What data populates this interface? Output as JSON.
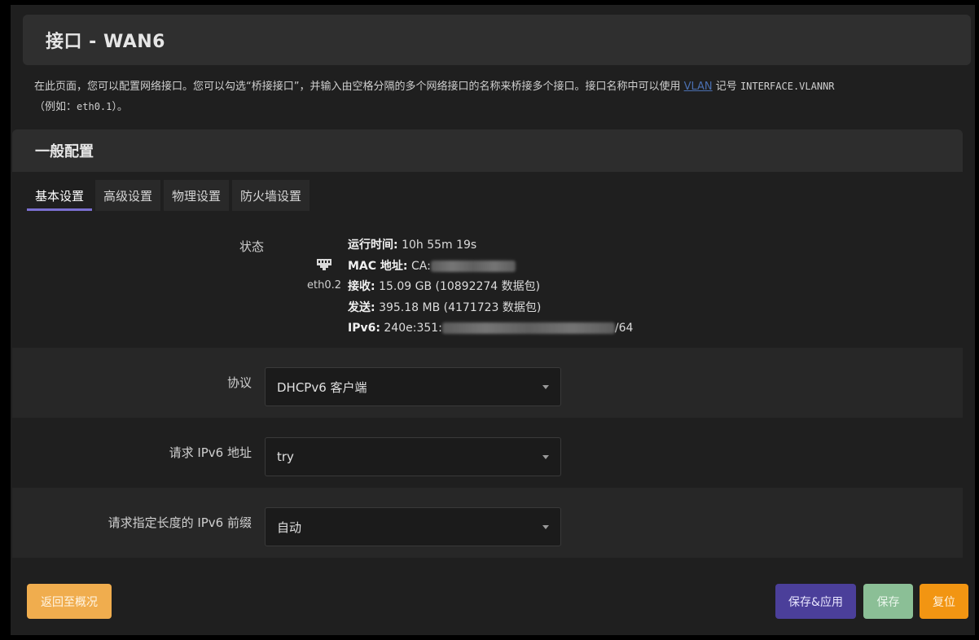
{
  "page": {
    "title": "接口 - WAN6",
    "description_parts": {
      "pre": "在此页面，您可以配置网络接口。您可以勾选“桥接接口”，并输入由空格分隔的多个网络接口的名称来桥接多个接口。接口名称中可以使用 ",
      "link": "VLAN",
      "mid": " 记号 ",
      "code1": "INTERFACE.VLANNR",
      "line2_pre": "（例如：",
      "code2": "eth0.1",
      "line2_post": "）。"
    }
  },
  "section": {
    "title": "一般配置",
    "tabs": [
      {
        "label": "基本设置",
        "active": true
      },
      {
        "label": "高级设置",
        "active": false
      },
      {
        "label": "物理设置",
        "active": false
      },
      {
        "label": "防火墙设置",
        "active": false
      }
    ]
  },
  "status": {
    "label": "状态",
    "interface": "eth0.2",
    "icon": "network-port-icon",
    "uptime_label": "运行时间:",
    "uptime_value": "10h 55m 19s",
    "mac_label": "MAC 地址:",
    "mac_value": "CA:",
    "rx_label": "接收:",
    "rx_value": "15.09 GB (10892274 数据包)",
    "tx_label": "发送:",
    "tx_value": "395.18 MB (4171723 数据包)",
    "ipv6_label": "IPv6:",
    "ipv6_value_pre": "240e:351:",
    "ipv6_value_post": "/64"
  },
  "form": {
    "protocol": {
      "label": "协议",
      "value": "DHCPv6 客户端"
    },
    "request_ipv6": {
      "label": "请求 IPv6 地址",
      "value": "try"
    },
    "prefix_length": {
      "label": "请求指定长度的 IPv6 前缀",
      "value": "自动"
    }
  },
  "buttons": {
    "back": "返回至概况",
    "save_apply": "保存&应用",
    "save": "保存",
    "reset": "复位"
  },
  "colors": {
    "back": "#f0ad4e",
    "save_apply": "#4b3f9a",
    "save": "#8bbf96",
    "reset": "#f29512",
    "tab_indicator": "#7a6fd0"
  }
}
